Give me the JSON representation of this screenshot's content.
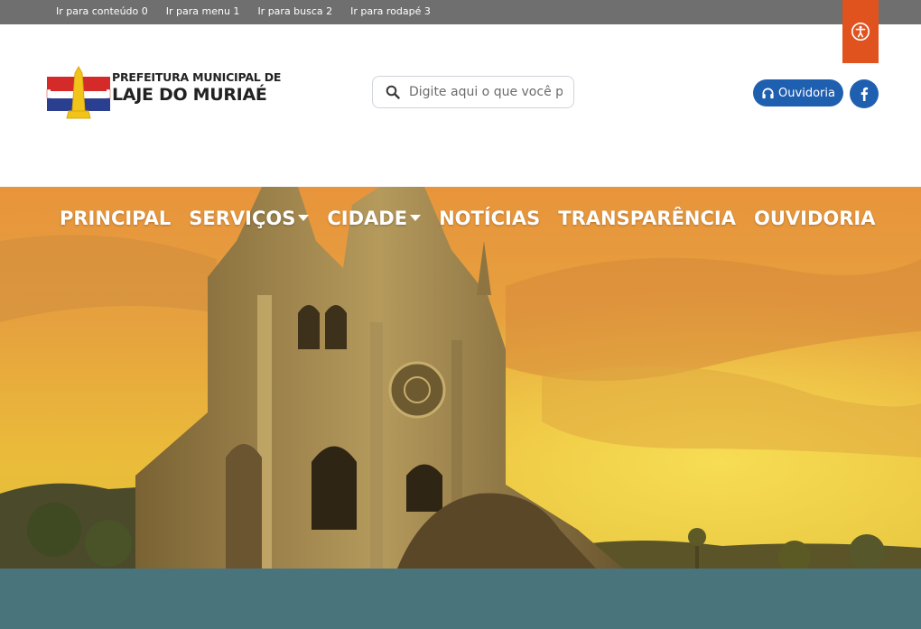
{
  "skip_links": [
    {
      "label": "Ir para conteúdo 0"
    },
    {
      "label": "Ir para menu 1"
    },
    {
      "label": "Ir para busca 2"
    },
    {
      "label": "Ir para rodapé 3"
    }
  ],
  "logo": {
    "line1": "PREFEITURA MUNICIPAL DE",
    "line2": "LAJE DO MURIAÉ"
  },
  "search": {
    "placeholder": "Digite aqui o que você procura",
    "icon": "search-icon"
  },
  "header_actions": {
    "ouvidoria_label": "Ouvidoria",
    "ouvidoria_icon": "headset-icon",
    "facebook_icon": "facebook-icon"
  },
  "accessibility": {
    "icon": "accessibility-icon"
  },
  "nav": {
    "items": [
      {
        "label": "PRINCIPAL"
      },
      {
        "label": "SERVIÇOS"
      },
      {
        "label": "CIDADE"
      },
      {
        "label": "NOTÍCIAS"
      },
      {
        "label": "TRANSPARÊNCIA"
      },
      {
        "label": "OUVIDORIA"
      }
    ]
  },
  "colors": {
    "skipbar": "#6f6f6f",
    "accent_orange": "#e0531f",
    "brand_blue": "#1f5fb0",
    "band_teal": "#4a747c"
  }
}
